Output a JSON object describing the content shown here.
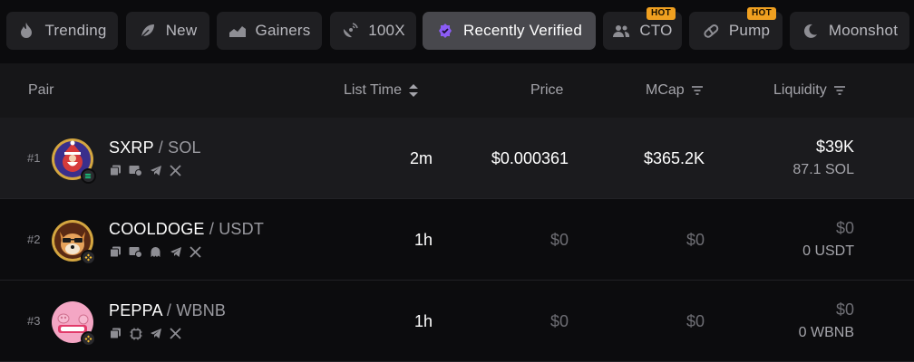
{
  "tabs": [
    {
      "label": "Trending",
      "icon": "flame-icon",
      "hot": ""
    },
    {
      "label": "New",
      "icon": "leaf-icon",
      "hot": ""
    },
    {
      "label": "Gainers",
      "icon": "chart-up-icon",
      "hot": ""
    },
    {
      "label": "100X",
      "icon": "satellite-icon",
      "hot": ""
    },
    {
      "label": "Recently Verified",
      "icon": "verified-badge-icon",
      "hot": "",
      "active": true
    },
    {
      "label": "CTO",
      "icon": "people-icon",
      "hot": "HOT"
    },
    {
      "label": "Pump",
      "icon": "pill-icon",
      "hot": "HOT"
    },
    {
      "label": "Moonshot",
      "icon": "moon-icon",
      "hot": ""
    }
  ],
  "columns": {
    "pair": "Pair",
    "list_time": "List Time",
    "price": "Price",
    "mcap": "MCap",
    "liquidity": "Liquidity"
  },
  "rows": [
    {
      "rank": "#1",
      "base": "SXRP",
      "sep": " / ",
      "quote": "SOL",
      "chain_icon": "solana-icon",
      "socials": [
        "copy-icon",
        "website-icon",
        "telegram-icon",
        "x-icon"
      ],
      "list_time": "2m",
      "price": "$0.000361",
      "mcap": "$365.2K",
      "liquidity": "$39K",
      "liquidity_sub": "87.1 SOL"
    },
    {
      "rank": "#2",
      "base": "COOLDOGE",
      "sep": " / ",
      "quote": "USDT",
      "chain_icon": "bnb-icon",
      "socials": [
        "copy-icon",
        "website-icon",
        "discord-icon",
        "telegram-icon",
        "x-icon"
      ],
      "list_time": "1h",
      "price": "$0",
      "mcap": "$0",
      "liquidity": "$0",
      "liquidity_sub": "0 USDT"
    },
    {
      "rank": "#3",
      "base": "PEPPA",
      "sep": " / ",
      "quote": "WBNB",
      "chain_icon": "bnb-icon",
      "socials": [
        "copy-icon",
        "contract-icon",
        "telegram-icon",
        "x-icon"
      ],
      "list_time": "1h",
      "price": "$0",
      "mcap": "$0",
      "liquidity": "$0",
      "liquidity_sub": "0 WBNB"
    }
  ],
  "colors": {
    "accent_hot": "#f0a020",
    "verified_badge": "#8b5cf6",
    "solana": "#14f195",
    "bnb": "#f3ba2f"
  }
}
